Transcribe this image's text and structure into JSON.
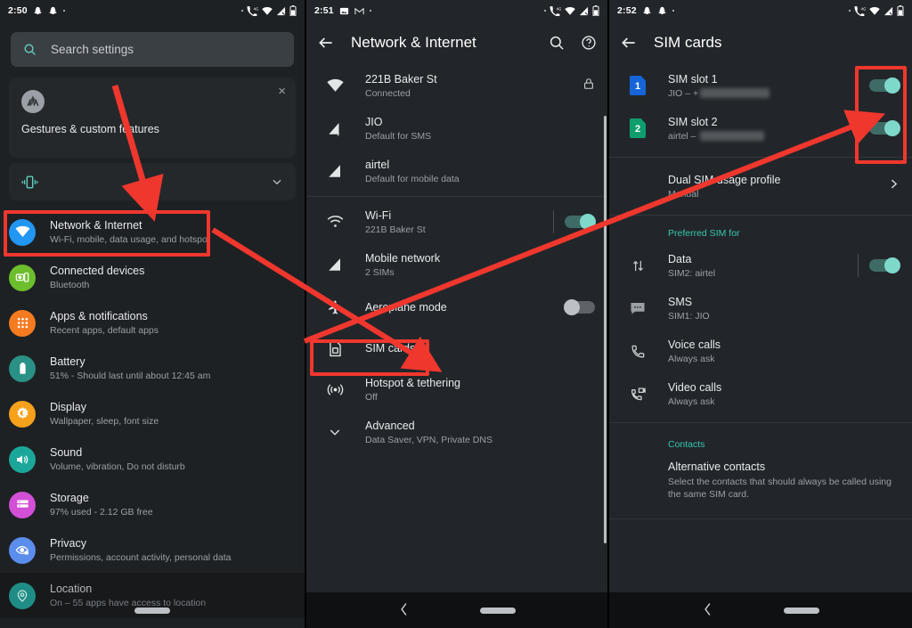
{
  "panel1": {
    "statusbar": {
      "time": "2:50",
      "left_icons": [
        "snapchat-icon",
        "snapchat-icon",
        "dot-icon"
      ],
      "right_icons": [
        "dot-icon",
        "call-4g-icon",
        "wifi-icon",
        "signal-icon",
        "battery-icon"
      ]
    },
    "search": {
      "placeholder": "Search settings",
      "icon": "search-icon"
    },
    "promo": {
      "title": "Gestures & custom features",
      "logo": "motorola-logo",
      "close": "×"
    },
    "vibration_card": {
      "icon": "vibration-icon",
      "chevron": "chevron-down-icon"
    },
    "items": [
      {
        "title": "Network & Internet",
        "subtitle": "Wi-Fi, mobile, data usage, and hotspot",
        "icon": "wifi-icon",
        "color": "#2196f3",
        "highlighted": true
      },
      {
        "title": "Connected devices",
        "subtitle": "Bluetooth",
        "icon": "devices-icon",
        "color": "#6cbe2c"
      },
      {
        "title": "Apps & notifications",
        "subtitle": "Recent apps, default apps",
        "icon": "apps-grid-icon",
        "color": "#f47b20"
      },
      {
        "title": "Battery",
        "subtitle": "51% - Should last until about 12:45 am",
        "icon": "battery-icon",
        "color": "#2a9187"
      },
      {
        "title": "Display",
        "subtitle": "Wallpaper, sleep, font size",
        "icon": "brightness-icon",
        "color": "#f6a11c"
      },
      {
        "title": "Sound",
        "subtitle": "Volume, vibration, Do not disturb",
        "icon": "volume-icon",
        "color": "#1aa79a"
      },
      {
        "title": "Storage",
        "subtitle": "97% used - 2.12 GB free",
        "icon": "storage-icon",
        "color": "#d24fd6"
      },
      {
        "title": "Privacy",
        "subtitle": "Permissions, account activity, personal data",
        "icon": "privacy-eye-icon",
        "color": "#5b8ded"
      },
      {
        "title": "Location",
        "subtitle": "On – 55 apps have access to location",
        "icon": "location-pin-icon",
        "color": "#1f8d85"
      }
    ]
  },
  "panel2": {
    "statusbar": {
      "time": "2:51",
      "left_icons": [
        "image-icon",
        "gmail-icon",
        "dot-icon"
      ],
      "right_icons": [
        "dot-icon",
        "call-4g-icon",
        "wifi-icon",
        "signal-icon",
        "battery-icon"
      ]
    },
    "appbar": {
      "back": "back-arrow-icon",
      "title": "Network & Internet",
      "search": "search-icon",
      "help": "help-icon"
    },
    "top_rows": [
      {
        "title": "221B Baker St",
        "subtitle": "Connected",
        "icon": "wifi-full-icon",
        "trail": "lock-icon"
      },
      {
        "title": "JIO",
        "subtitle": "Default for SMS",
        "icon": "signal-no-data-icon"
      },
      {
        "title": "airtel",
        "subtitle": "Default for mobile data",
        "icon": "signal-icon"
      }
    ],
    "rows": [
      {
        "title": "Wi-Fi",
        "subtitle": "221B Baker St",
        "icon": "wifi-icon",
        "toggle": "on"
      },
      {
        "title": "Mobile network",
        "subtitle": "2 SIMs",
        "icon": "signal-icon"
      },
      {
        "title": "Aeroplane mode",
        "subtitle": "",
        "icon": "airplane-icon",
        "toggle": "off"
      },
      {
        "title": "SIM cards",
        "subtitle": "",
        "icon": "sim-card-icon",
        "highlighted": true
      },
      {
        "title": "Hotspot & tethering",
        "subtitle": "Off",
        "icon": "hotspot-icon"
      },
      {
        "title": "Advanced",
        "subtitle": "Data Saver, VPN, Private DNS",
        "icon": "chevron-down-icon"
      }
    ],
    "navbar": {
      "back": "back-chevron-icon",
      "home": "home-pill"
    }
  },
  "panel3": {
    "statusbar": {
      "time": "2:52",
      "left_icons": [
        "snapchat-icon",
        "snapchat-icon",
        "dot-icon"
      ],
      "right_icons": [
        "dot-icon",
        "call-4g-icon",
        "wifi-icon",
        "signal-icon",
        "battery-icon"
      ]
    },
    "appbar": {
      "back": "back-arrow-icon",
      "title": "SIM cards"
    },
    "slots": [
      {
        "title": "SIM slot 1",
        "subtitle": "JIO – +",
        "badge": "1",
        "color": "#1565d8",
        "toggle": "on",
        "redacted": true
      },
      {
        "title": "SIM slot 2",
        "subtitle": "airtel – ",
        "badge": "2",
        "color": "#0f9d6e",
        "toggle": "on",
        "redacted": true
      }
    ],
    "dual_sim": {
      "title": "Dual SIM usage profile",
      "subtitle": "Manual",
      "chevron": "chevron-right-icon"
    },
    "preferred_header": "Preferred SIM for",
    "preferred": [
      {
        "title": "Data",
        "subtitle": "SIM2: airtel",
        "icon": "data-arrows-icon",
        "toggle": "on"
      },
      {
        "title": "SMS",
        "subtitle": "SIM1: JIO",
        "icon": "sms-icon"
      },
      {
        "title": "Voice calls",
        "subtitle": "Always ask",
        "icon": "phone-icon"
      },
      {
        "title": "Video calls",
        "subtitle": "Always ask",
        "icon": "video-call-icon"
      }
    ],
    "contacts_header": "Contacts",
    "contacts": {
      "title": "Alternative contacts",
      "subtitle": "Select the contacts that should always be called using the same SIM card."
    },
    "navbar": {
      "back": "back-chevron-icon",
      "home": "home-pill"
    }
  },
  "annotations": {
    "color": "#f0372e"
  }
}
